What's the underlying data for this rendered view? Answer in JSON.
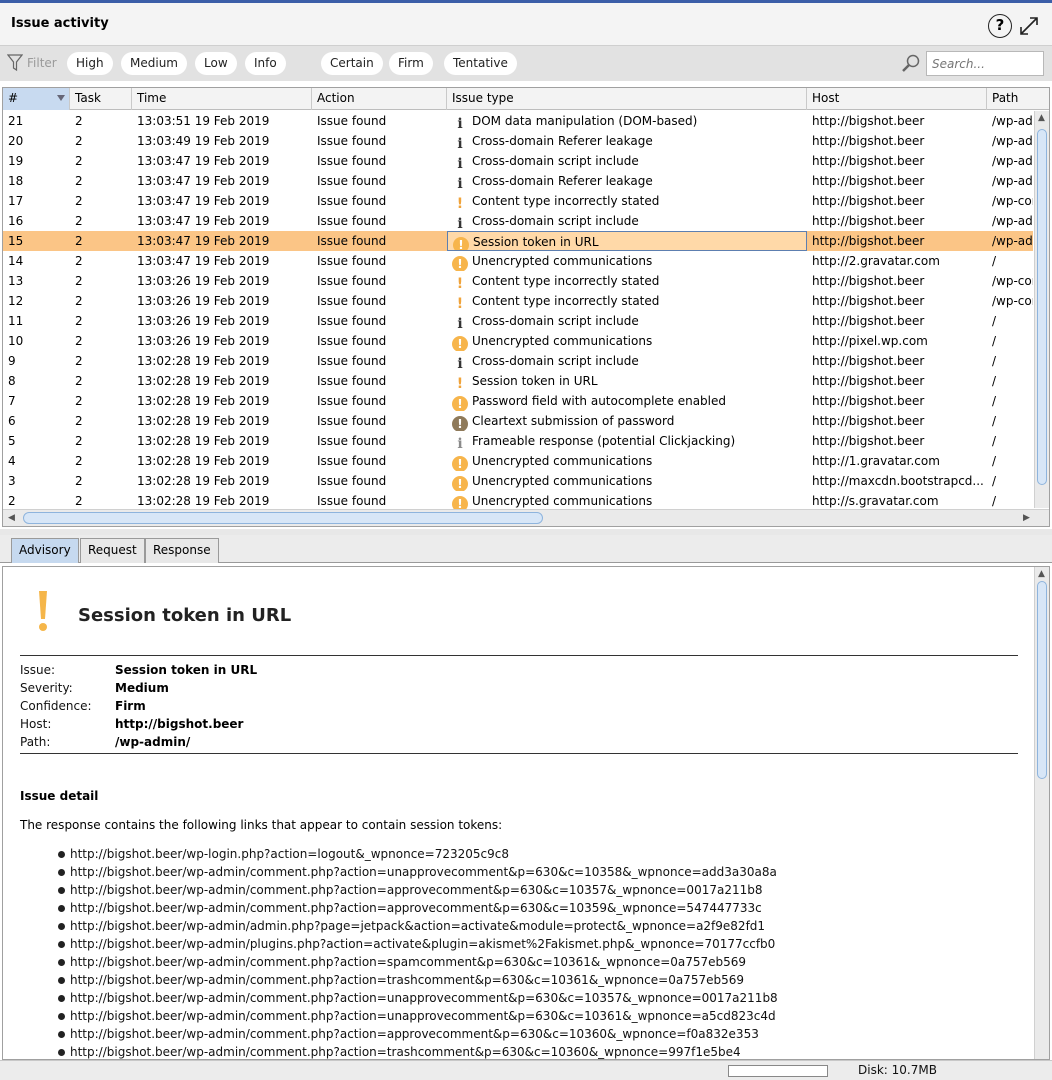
{
  "header": {
    "title": "Issue activity"
  },
  "filter": {
    "label": "Filter",
    "severity_pills": [
      "High",
      "Medium",
      "Low",
      "Info"
    ],
    "confidence_pills": [
      "Certain",
      "Firm",
      "Tentative"
    ],
    "search_placeholder": "Search..."
  },
  "table": {
    "columns": [
      "#",
      "Task",
      "Time",
      "Action",
      "Issue type",
      "Host",
      "Path"
    ],
    "selected_index": 6,
    "rows": [
      {
        "num": "21",
        "task": "2",
        "time": "13:03:51 19 Feb 2019",
        "action": "Issue found",
        "icon": "info-icon",
        "issue": "DOM data manipulation (DOM-based)",
        "host": "http://bigshot.beer",
        "path": "/wp-adr"
      },
      {
        "num": "20",
        "task": "2",
        "time": "13:03:49 19 Feb 2019",
        "action": "Issue found",
        "icon": "info-icon",
        "issue": "Cross-domain Referer leakage",
        "host": "http://bigshot.beer",
        "path": "/wp-adr"
      },
      {
        "num": "19",
        "task": "2",
        "time": "13:03:47 19 Feb 2019",
        "action": "Issue found",
        "icon": "info-icon",
        "issue": "Cross-domain script include",
        "host": "http://bigshot.beer",
        "path": "/wp-adr"
      },
      {
        "num": "18",
        "task": "2",
        "time": "13:03:47 19 Feb 2019",
        "action": "Issue found",
        "icon": "info-icon",
        "issue": "Cross-domain Referer leakage",
        "host": "http://bigshot.beer",
        "path": "/wp-adr"
      },
      {
        "num": "17",
        "task": "2",
        "time": "13:03:47 19 Feb 2019",
        "action": "Issue found",
        "icon": "low-icon",
        "issue": "Content type incorrectly stated",
        "host": "http://bigshot.beer",
        "path": "/wp-cor"
      },
      {
        "num": "16",
        "task": "2",
        "time": "13:03:47 19 Feb 2019",
        "action": "Issue found",
        "icon": "info-icon",
        "issue": "Cross-domain script include",
        "host": "http://bigshot.beer",
        "path": "/wp-adr"
      },
      {
        "num": "15",
        "task": "2",
        "time": "13:03:47 19 Feb 2019",
        "action": "Issue found",
        "icon": "medium-icon",
        "issue": "Session token in URL",
        "host": "http://bigshot.beer",
        "path": "/wp-adr"
      },
      {
        "num": "14",
        "task": "2",
        "time": "13:03:47 19 Feb 2019",
        "action": "Issue found",
        "icon": "medium-icon",
        "issue": "Unencrypted communications",
        "host": "http://2.gravatar.com",
        "path": "/"
      },
      {
        "num": "13",
        "task": "2",
        "time": "13:03:26 19 Feb 2019",
        "action": "Issue found",
        "icon": "low-icon",
        "issue": "Content type incorrectly stated",
        "host": "http://bigshot.beer",
        "path": "/wp-cor"
      },
      {
        "num": "12",
        "task": "2",
        "time": "13:03:26 19 Feb 2019",
        "action": "Issue found",
        "icon": "low-icon",
        "issue": "Content type incorrectly stated",
        "host": "http://bigshot.beer",
        "path": "/wp-cor"
      },
      {
        "num": "11",
        "task": "2",
        "time": "13:03:26 19 Feb 2019",
        "action": "Issue found",
        "icon": "info-icon",
        "issue": "Cross-domain script include",
        "host": "http://bigshot.beer",
        "path": "/"
      },
      {
        "num": "10",
        "task": "2",
        "time": "13:03:26 19 Feb 2019",
        "action": "Issue found",
        "icon": "medium-icon",
        "issue": "Unencrypted communications",
        "host": "http://pixel.wp.com",
        "path": "/"
      },
      {
        "num": "9",
        "task": "2",
        "time": "13:02:28 19 Feb 2019",
        "action": "Issue found",
        "icon": "info-icon",
        "issue": "Cross-domain script include",
        "host": "http://bigshot.beer",
        "path": "/"
      },
      {
        "num": "8",
        "task": "2",
        "time": "13:02:28 19 Feb 2019",
        "action": "Issue found",
        "icon": "low-icon",
        "issue": "Session token in URL",
        "host": "http://bigshot.beer",
        "path": "/"
      },
      {
        "num": "7",
        "task": "2",
        "time": "13:02:28 19 Feb 2019",
        "action": "Issue found",
        "icon": "medium-icon",
        "issue": "Password field with autocomplete enabled",
        "host": "http://bigshot.beer",
        "path": "/"
      },
      {
        "num": "6",
        "task": "2",
        "time": "13:02:28 19 Feb 2019",
        "action": "Issue found",
        "icon": "high-icon",
        "issue": "Cleartext submission of password",
        "host": "http://bigshot.beer",
        "path": "/"
      },
      {
        "num": "5",
        "task": "2",
        "time": "13:02:28 19 Feb 2019",
        "action": "Issue found",
        "icon": "info-light-icon",
        "issue": "Frameable response (potential Clickjacking)",
        "host": "http://bigshot.beer",
        "path": "/"
      },
      {
        "num": "4",
        "task": "2",
        "time": "13:02:28 19 Feb 2019",
        "action": "Issue found",
        "icon": "medium-icon",
        "issue": "Unencrypted communications",
        "host": "http://1.gravatar.com",
        "path": "/"
      },
      {
        "num": "3",
        "task": "2",
        "time": "13:02:28 19 Feb 2019",
        "action": "Issue found",
        "icon": "medium-icon",
        "issue": "Unencrypted communications",
        "host": "http://maxcdn.bootstrapcd...",
        "path": "/"
      },
      {
        "num": "2",
        "task": "2",
        "time": "13:02:28 19 Feb 2019",
        "action": "Issue found",
        "icon": "medium-icon",
        "issue": "Unencrypted communications",
        "host": "http://s.gravatar.com",
        "path": "/"
      }
    ]
  },
  "tabs": [
    "Advisory",
    "Request",
    "Response"
  ],
  "advisory": {
    "title": "Session token in URL",
    "fields": [
      {
        "key": "Issue:",
        "value": "Session token in URL"
      },
      {
        "key": "Severity:",
        "value": "Medium"
      },
      {
        "key": "Confidence:",
        "value": "Firm"
      },
      {
        "key": "Host:",
        "value": "http://bigshot.beer"
      },
      {
        "key": "Path:",
        "value": "/wp-admin/"
      }
    ],
    "detail_heading": "Issue detail",
    "detail_text": "The response contains the following links that appear to contain session tokens:",
    "links": [
      "http://bigshot.beer/wp-login.php?action=logout&_wpnonce=723205c9c8",
      "http://bigshot.beer/wp-admin/comment.php?action=unapprovecomment&p=630&c=10358&_wpnonce=add3a30a8a",
      "http://bigshot.beer/wp-admin/comment.php?action=approvecomment&p=630&c=10357&_wpnonce=0017a211b8",
      "http://bigshot.beer/wp-admin/comment.php?action=approvecomment&p=630&c=10359&_wpnonce=547447733c",
      "http://bigshot.beer/wp-admin/admin.php?page=jetpack&action=activate&module=protect&_wpnonce=a2f9e82fd1",
      "http://bigshot.beer/wp-admin/plugins.php?action=activate&plugin=akismet%2Fakismet.php&_wpnonce=70177ccfb0",
      "http://bigshot.beer/wp-admin/comment.php?action=spamcomment&p=630&c=10361&_wpnonce=0a757eb569",
      "http://bigshot.beer/wp-admin/comment.php?action=trashcomment&p=630&c=10361&_wpnonce=0a757eb569",
      "http://bigshot.beer/wp-admin/comment.php?action=unapprovecomment&p=630&c=10357&_wpnonce=0017a211b8",
      "http://bigshot.beer/wp-admin/comment.php?action=unapprovecomment&p=630&c=10361&_wpnonce=a5cd823c4d",
      "http://bigshot.beer/wp-admin/comment.php?action=approvecomment&p=630&c=10360&_wpnonce=f0a832e353",
      "http://bigshot.beer/wp-admin/comment.php?action=trashcomment&p=630&c=10360&_wpnonce=997f1e5be4"
    ]
  },
  "status": {
    "disk": "Disk: 10.7MB"
  },
  "colors": {
    "selected_row": "#fbc586",
    "accent": "#3b5ea8",
    "medium": "#f7b54c"
  }
}
